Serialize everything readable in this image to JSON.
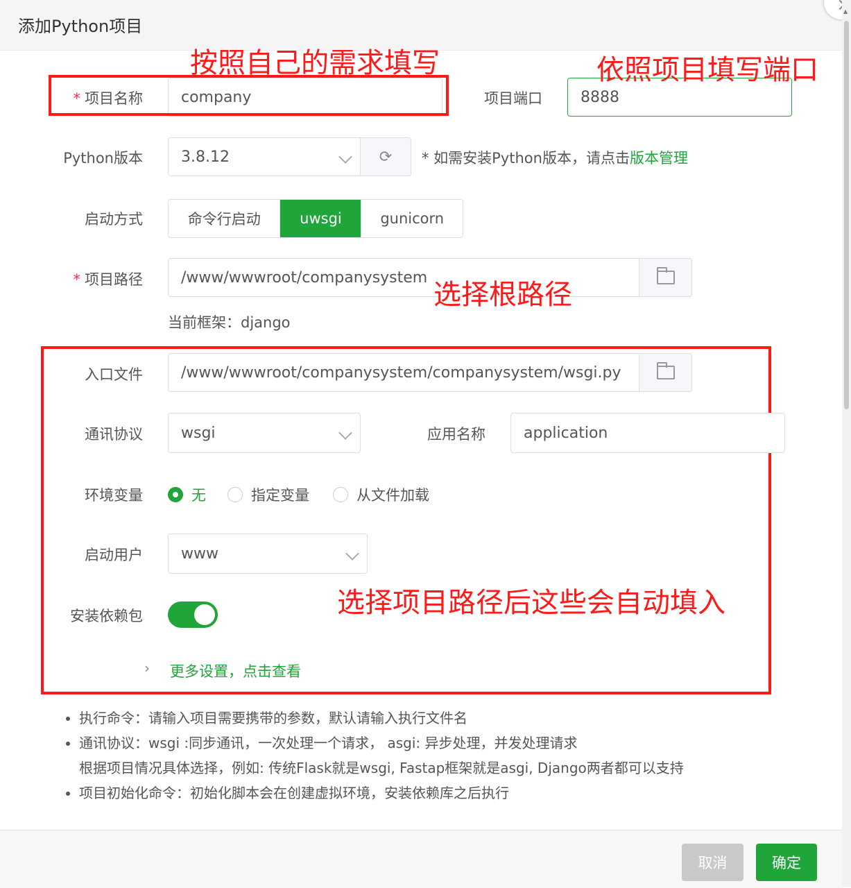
{
  "dialog": {
    "title": "添加Python项目",
    "close_icon": "close-icon"
  },
  "annotations": {
    "name_hint": "按照自己的需求填写",
    "port_hint": "依照项目填写端口",
    "path_hint": "选择根路径",
    "auto_hint": "选择项目路径后这些会自动填入"
  },
  "form": {
    "project_name": {
      "label": "项目名称",
      "required": "*",
      "value": "company"
    },
    "project_port": {
      "label": "项目端口",
      "value": "8888"
    },
    "python_version": {
      "label": "Python版本",
      "value": "3.8.12",
      "note": "* 如需安装Python版本，请点击",
      "link": "版本管理"
    },
    "start_mode": {
      "label": "启动方式",
      "options": [
        "命令行启动",
        "uwsgi",
        "gunicorn"
      ],
      "selected": "uwsgi"
    },
    "project_path": {
      "label": "项目路径",
      "required": "*",
      "value": "/www/wwwroot/companysystem",
      "framework": "当前框架：django"
    },
    "entry_file": {
      "label": "入口文件",
      "value": "/www/wwwroot/companysystem/companysystem/wsgi.py"
    },
    "protocol": {
      "label": "通讯协议",
      "value": "wsgi"
    },
    "app_name": {
      "label": "应用名称",
      "value": "application"
    },
    "env": {
      "label": "环境变量",
      "options": [
        "无",
        "指定变量",
        "从文件加载"
      ],
      "selected": "无"
    },
    "run_user": {
      "label": "启动用户",
      "value": "www"
    },
    "install_deps": {
      "label": "安装依赖包",
      "enabled": true
    },
    "more_settings": "更多设置，点击查看"
  },
  "help": {
    "items": [
      "执行命令：请输入项目需要携带的参数，默认请输入执行文件名",
      "通讯协议：wsgi :同步通讯，一次处理一个请求， asgi: 异步处理，并发处理请求",
      "根据项目情况具体选择，例如: 传统Flask就是wsgi, Fastap框架就是asgi, Django两者都可以支持",
      "项目初始化命令：初始化脚本会在创建虚拟环境，安装依赖库之后执行"
    ]
  },
  "footer": {
    "cancel": "取消",
    "confirm": "确定"
  },
  "colors": {
    "accent": "#20a53a",
    "annotation": "#ff1a1a"
  }
}
